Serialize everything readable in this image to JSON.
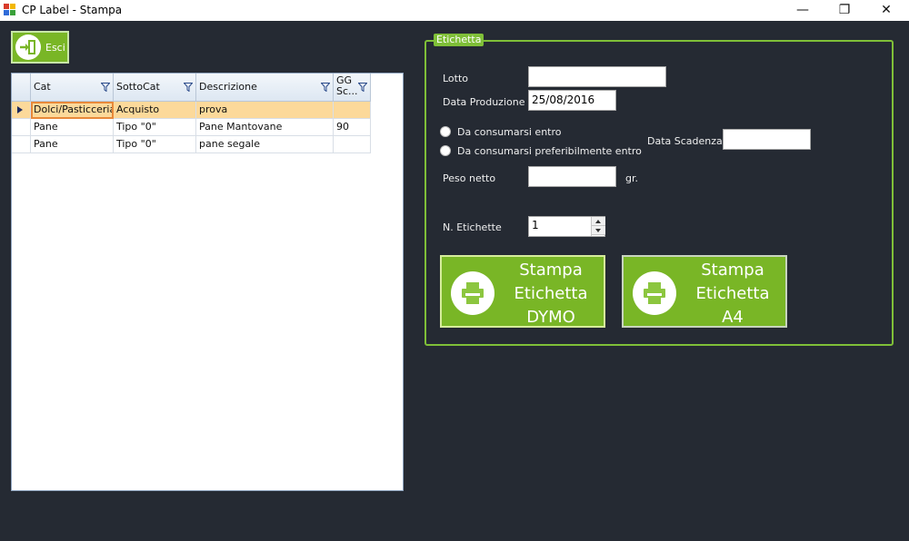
{
  "window": {
    "title": "CP Label - Stampa",
    "minimize_glyph": "—",
    "restore_glyph": "❐",
    "close_glyph": "✕"
  },
  "toolbar": {
    "exit_label": "Esci",
    "exit_icon": "exit-door-icon"
  },
  "grid": {
    "columns": [
      "Cat",
      "SottoCat",
      "Descrizione",
      "GG Sc..."
    ],
    "column_header_gg_line1": "GG",
    "column_header_gg_line2": "Sc...",
    "rows": [
      {
        "cat": "Dolci/Pasticceria",
        "sottocat": "Acquisto",
        "descrizione": "prova",
        "gg": "",
        "selected": true
      },
      {
        "cat": "Pane",
        "sottocat": "Tipo \"0\"",
        "descrizione": "Pane Mantovane",
        "gg": "90",
        "selected": false
      },
      {
        "cat": "Pane",
        "sottocat": "Tipo \"0\"",
        "descrizione": "pane segale",
        "gg": "",
        "selected": false
      }
    ]
  },
  "etichetta": {
    "group_title": "Etichetta",
    "lotto_label": "Lotto",
    "lotto_value": "",
    "data_produzione_label": "Data Produzione",
    "data_produzione_value": "25/08/2016",
    "radio_entro_label": "Da consumarsi entro",
    "radio_pref_label": "Da consumarsi preferibilmente entro",
    "data_scadenza_label": "Data Scadenza",
    "data_scadenza_value": "",
    "peso_netto_label": "Peso netto",
    "peso_netto_value": "",
    "peso_unit": "gr.",
    "n_etichette_label": "N. Etichette",
    "n_etichette_value": "1"
  },
  "buttons": {
    "dymo_line1": "Stampa",
    "dymo_line2": "Etichetta",
    "dymo_line3": "DYMO",
    "a4_line1": "Stampa",
    "a4_line2": "Etichetta",
    "a4_line3": "A4",
    "print_icon": "printer-icon"
  },
  "colors": {
    "background": "#252a33",
    "accent_green": "#79b626",
    "selection": "#fcd99a"
  }
}
